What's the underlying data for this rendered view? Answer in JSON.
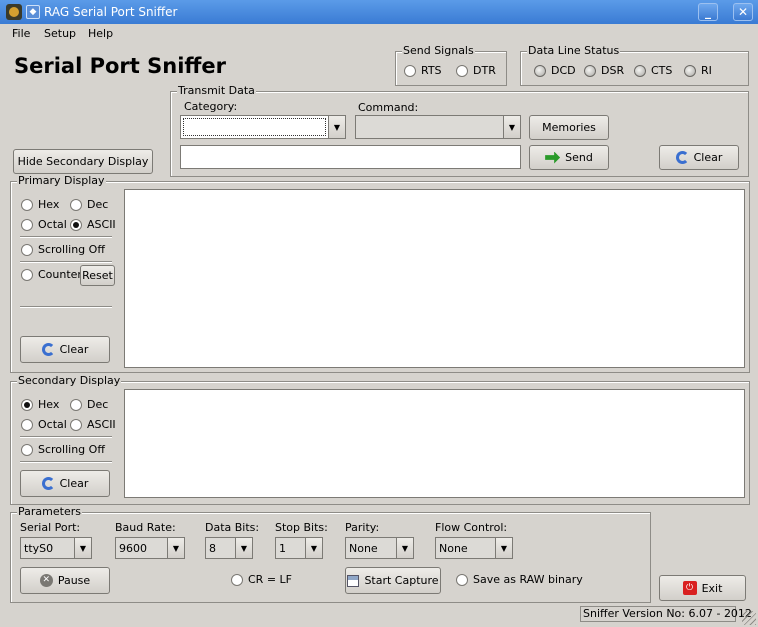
{
  "window": {
    "title": "RAG Serial Port Sniffer",
    "minimize_label": "_",
    "close_label": "✕"
  },
  "menu": [
    "File",
    "Setup",
    "Help"
  ],
  "app_title": "Serial Port Sniffer",
  "send_signals": {
    "legend": "Send Signals",
    "rts": "RTS",
    "dtr": "DTR"
  },
  "data_line_status": {
    "legend": "Data Line Status",
    "dcd": "DCD",
    "dsr": "DSR",
    "cts": "CTS",
    "ri": "RI"
  },
  "transmit": {
    "legend": "Transmit Data",
    "category_label": "Category:",
    "category_value": "",
    "command_label": "Command:",
    "command_value": "",
    "input_value": "",
    "memories_label": "Memories",
    "send_label": "Send",
    "clear_label": "Clear"
  },
  "hide_secondary_label": "Hide Secondary Display",
  "primary": {
    "legend": "Primary Display",
    "hex": "Hex",
    "dec": "Dec",
    "octal": "Octal",
    "ascii": "ASCII",
    "selected": "ASCII",
    "scrolling_off": "Scrolling Off",
    "counter": "Counter",
    "reset": "Reset",
    "clear": "Clear"
  },
  "secondary": {
    "legend": "Secondary Display",
    "hex": "Hex",
    "dec": "Dec",
    "octal": "Octal",
    "ascii": "ASCII",
    "selected": "Hex",
    "scrolling_off": "Scrolling Off",
    "clear": "Clear"
  },
  "parameters": {
    "legend": "Parameters",
    "serial_port": {
      "label": "Serial Port:",
      "value": "ttyS0"
    },
    "baud_rate": {
      "label": "Baud Rate:",
      "value": "9600"
    },
    "data_bits": {
      "label": "Data Bits:",
      "value": "8"
    },
    "stop_bits": {
      "label": "Stop Bits:",
      "value": "1"
    },
    "parity": {
      "label": "Parity:",
      "value": "None"
    },
    "flow_control": {
      "label": "Flow Control:",
      "value": "None"
    },
    "pause": "Pause",
    "cr_lf": "CR = LF",
    "start_capture": "Start Capture",
    "save_raw": "Save as RAW binary"
  },
  "exit_label": "Exit",
  "version": "Sniffer Version No: 6.07 - 2012",
  "colors": {
    "titlebar": "#3a7bd4",
    "background": "#d6d3ce",
    "exit_icon": "#d92020",
    "send_icon": "#2a9a2a",
    "refresh_icon": "#3a6fd0"
  }
}
